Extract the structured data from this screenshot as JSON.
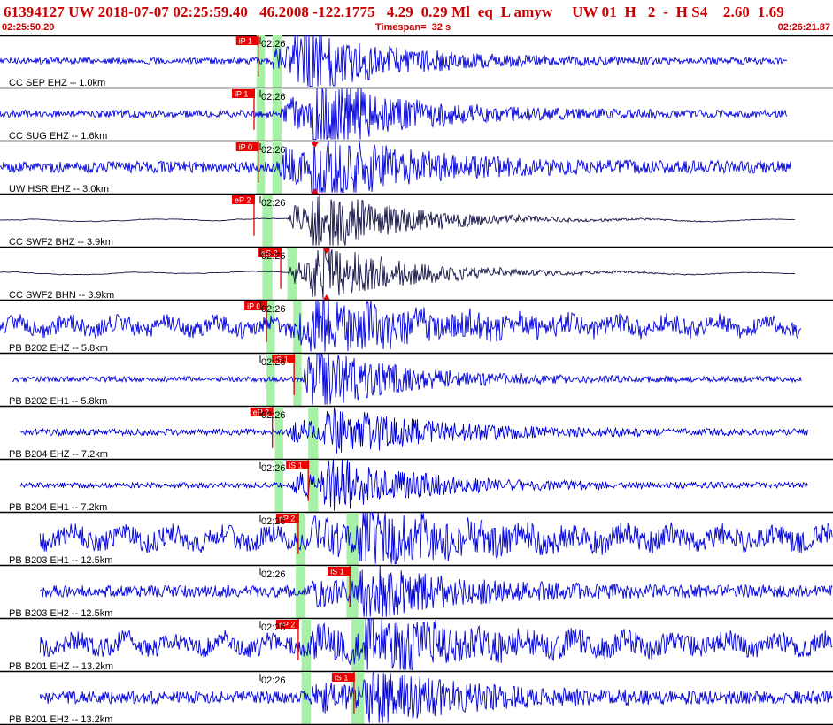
{
  "header": {
    "title": "61394127 UW 2018-07-07 02:25:59.40   46.2008 -122.1775   4.29  0.29 Ml  eq  L amyw     UW 01  H   2  -  H S4    2.60  1.69",
    "start_time": "02:25:50.20",
    "timespan": "Timespan=  32 s",
    "end_time": "02:26:21.87"
  },
  "colors": {
    "header_text": "#cc0000",
    "trace_blue": "#0000dd",
    "trace_black": "#111144",
    "pick_box": "#ee0000",
    "pick_line": "#dd0000",
    "window_green": "#a8f0a8",
    "divider": "#000000",
    "label": "#000000"
  },
  "tick_label": "02:26",
  "traces": [
    {
      "label": "CC SEP EHZ -- 1.0km",
      "color": "blue",
      "amp": 0.55,
      "noise": 0.12,
      "onset": 0.325,
      "s_onset": 0.35,
      "end_frac": 0.945,
      "start_frac": 0.0,
      "picks": [
        {
          "label": "iP 1",
          "pos": 0.31
        }
      ],
      "windows": [
        [
          0.308,
          0.318
        ],
        [
          0.327,
          0.338
        ]
      ]
    },
    {
      "label": "CC SUG EHZ -- 1.6km",
      "color": "blue",
      "amp": 0.6,
      "noise": 0.14,
      "onset": 0.335,
      "s_onset": 0.37,
      "end_frac": 0.945,
      "start_frac": 0.0,
      "picks": [
        {
          "label": "iP 1",
          "pos": 0.305
        }
      ],
      "windows": [
        [
          0.308,
          0.318
        ],
        [
          0.327,
          0.338
        ]
      ]
    },
    {
      "label": "UW HSR EHZ -- 3.0km",
      "color": "blue",
      "amp": 0.6,
      "noise": 0.22,
      "onset": 0.335,
      "s_onset": 0.37,
      "end_frac": 0.95,
      "start_frac": 0.0,
      "picks": [
        {
          "label": "iP 0",
          "pos": 0.31
        }
      ],
      "windows": [
        [
          0.308,
          0.318
        ],
        [
          0.327,
          0.338
        ]
      ],
      "marker": 0.378
    },
    {
      "label": "CC SWF2 BHZ -- 3.9km",
      "color": "black",
      "amp": 0.55,
      "noise": 0.06,
      "onset": 0.345,
      "s_onset": 0.37,
      "end_frac": 0.955,
      "start_frac": 0.0,
      "picks": [
        {
          "label": "eP 2",
          "pos": 0.305
        }
      ],
      "windows": [
        [
          0.315,
          0.327
        ]
      ]
    },
    {
      "label": "CC SWF2 BHN -- 3.9km",
      "color": "black",
      "amp": 0.55,
      "noise": 0.06,
      "onset": 0.345,
      "s_onset": 0.37,
      "end_frac": 0.955,
      "start_frac": 0.0,
      "picks": [
        {
          "label": "eS 2",
          "pos": 0.337
        }
      ],
      "windows": [
        [
          0.315,
          0.327
        ],
        [
          0.345,
          0.357
        ]
      ],
      "marker": 0.392
    },
    {
      "label": "PB B202 EHZ -- 5.8km",
      "color": "blue",
      "amp": 0.45,
      "noise": 0.32,
      "onset": 0.355,
      "s_onset": 0.37,
      "end_frac": 0.962,
      "start_frac": 0.0,
      "picks": [
        {
          "label": "iP 0",
          "pos": 0.32
        }
      ],
      "windows": [
        [
          0.32,
          0.33
        ],
        [
          0.352,
          0.362
        ]
      ]
    },
    {
      "label": "PB B202 EH1 -- 5.8km",
      "color": "blue",
      "amp": 0.45,
      "noise": 0.1,
      "onset": 0.36,
      "s_onset": 0.368,
      "end_frac": 0.962,
      "start_frac": 0.015,
      "picks": [
        {
          "label": "iS 1",
          "pos": 0.353
        }
      ],
      "windows": [
        [
          0.32,
          0.33
        ],
        [
          0.352,
          0.362
        ]
      ]
    },
    {
      "label": "PB B204 EHZ -- 7.2km",
      "color": "blue",
      "amp": 0.45,
      "noise": 0.12,
      "onset": 0.345,
      "s_onset": 0.385,
      "end_frac": 0.97,
      "start_frac": 0.025,
      "picks": [
        {
          "label": "eP 2",
          "pos": 0.327
        }
      ],
      "windows": [
        [
          0.33,
          0.34
        ],
        [
          0.37,
          0.382
        ]
      ]
    },
    {
      "label": "PB B204 EH1 -- 7.2km",
      "color": "blue",
      "amp": 0.45,
      "noise": 0.1,
      "onset": 0.35,
      "s_onset": 0.385,
      "end_frac": 0.97,
      "start_frac": 0.025,
      "picks": [
        {
          "label": "iS 1",
          "pos": 0.37
        }
      ],
      "windows": [
        [
          0.33,
          0.34
        ],
        [
          0.37,
          0.382
        ]
      ]
    },
    {
      "label": "PB B203 EH1 -- 12.5km",
      "color": "blue",
      "amp": 0.5,
      "noise": 0.38,
      "onset": 0.37,
      "s_onset": 0.43,
      "end_frac": 1.0,
      "start_frac": 0.048,
      "picks": [
        {
          "label": "eP 2",
          "pos": 0.358
        }
      ],
      "windows": [
        [
          0.355,
          0.366
        ],
        [
          0.416,
          0.43
        ]
      ]
    },
    {
      "label": "PB B203 EH2 -- 12.5km",
      "color": "blue",
      "amp": 0.45,
      "noise": 0.22,
      "onset": 0.37,
      "s_onset": 0.43,
      "end_frac": 1.0,
      "start_frac": 0.048,
      "picks": [
        {
          "label": "iS 1",
          "pos": 0.42
        }
      ],
      "windows": [
        [
          0.355,
          0.366
        ],
        [
          0.416,
          0.43
        ]
      ]
    },
    {
      "label": "PB B201 EHZ -- 13.2km",
      "color": "blue",
      "amp": 0.5,
      "noise": 0.36,
      "onset": 0.372,
      "s_onset": 0.435,
      "end_frac": 1.0,
      "start_frac": 0.048,
      "picks": [
        {
          "label": "eP 2",
          "pos": 0.358
        }
      ],
      "windows": [
        [
          0.362,
          0.373
        ],
        [
          0.422,
          0.437
        ]
      ]
    },
    {
      "label": "PB B201 EH2 -- 13.2km",
      "color": "blue",
      "amp": 0.45,
      "noise": 0.24,
      "onset": 0.372,
      "s_onset": 0.435,
      "end_frac": 1.0,
      "start_frac": 0.048,
      "picks": [
        {
          "label": "iS 1",
          "pos": 0.425
        }
      ],
      "windows": [
        [
          0.362,
          0.373
        ],
        [
          0.422,
          0.437
        ]
      ]
    }
  ]
}
